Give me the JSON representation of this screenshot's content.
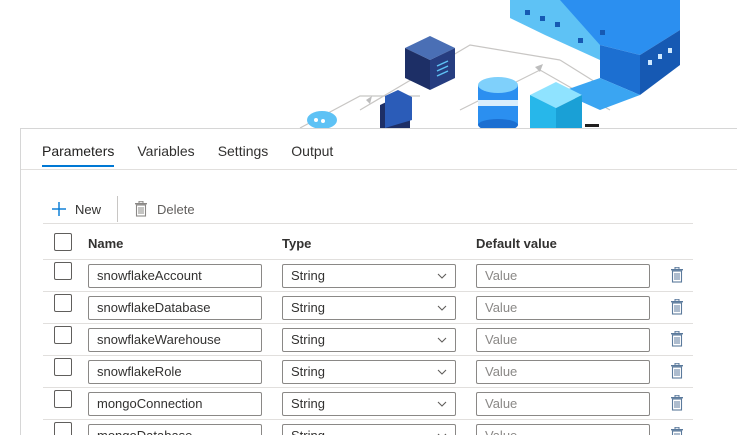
{
  "tabs": [
    {
      "label": "Parameters",
      "active": true
    },
    {
      "label": "Variables",
      "active": false
    },
    {
      "label": "Settings",
      "active": false
    },
    {
      "label": "Output",
      "active": false
    }
  ],
  "toolbar": {
    "new_label": "New",
    "delete_label": "Delete"
  },
  "table": {
    "headers": {
      "name": "Name",
      "type": "Type",
      "default": "Default value"
    },
    "rows": [
      {
        "name": "snowflakeAccount",
        "type": "String",
        "default_placeholder": "Value"
      },
      {
        "name": "snowflakeDatabase",
        "type": "String",
        "default_placeholder": "Value"
      },
      {
        "name": "snowflakeWarehouse",
        "type": "String",
        "default_placeholder": "Value"
      },
      {
        "name": "snowflakeRole",
        "type": "String",
        "default_placeholder": "Value"
      },
      {
        "name": "mongoConnection",
        "type": "String",
        "default_placeholder": "Value"
      },
      {
        "name": "mongoDatabase",
        "type": "String",
        "default_placeholder": "Value"
      }
    ]
  },
  "colors": {
    "accent": "#0078d4",
    "hero_blue": "#1e90ff",
    "hero_dark": "#1f3b73",
    "trash": "#5b7a9c"
  }
}
